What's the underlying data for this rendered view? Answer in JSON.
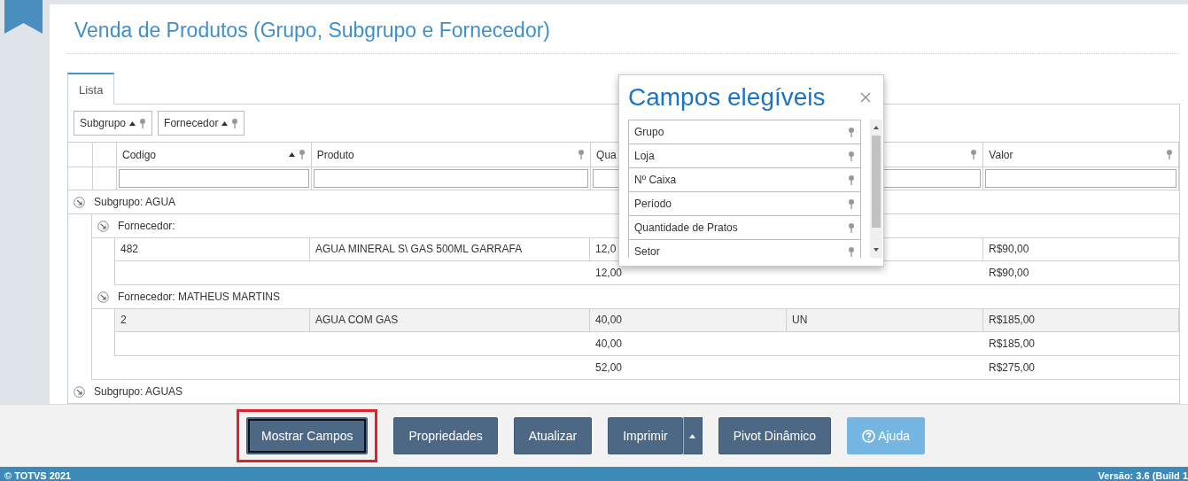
{
  "page": {
    "title": "Venda de Produtos (Grupo, Subgrupo e Fornecedor)"
  },
  "tabs": [
    {
      "label": "Lista",
      "selected": true
    }
  ],
  "group_panel": [
    {
      "label": "Subgrupo",
      "sorted": true
    },
    {
      "label": "Fornecedor",
      "sorted": true
    }
  ],
  "table": {
    "columns": [
      {
        "label": "Codigo",
        "sorted": true
      },
      {
        "label": "Produto",
        "sorted": false
      },
      {
        "label": "Qua",
        "sorted": false
      },
      {
        "sorted": false
      },
      {
        "label": "Valor",
        "sorted": false
      }
    ],
    "groups": [
      {
        "label": "Subgrupo: AGUA",
        "expanded": true,
        "children": [
          {
            "label": "Fornecedor:",
            "expanded": true,
            "rows": [
              {
                "cells": [
                  "482",
                  "AGUA MINERAL S\\ GAS 500ML GARRAFA",
                  "12,0",
                  null,
                  "R$90,00"
                ],
                "selected": false
              }
            ],
            "summary": {
              "col_3": "12,00",
              "col_5": "R$90,00"
            }
          },
          {
            "label": "Fornecedor: MATHEUS MARTINS",
            "expanded": true,
            "rows": [
              {
                "cells": [
                  "2",
                  "AGUA COM GAS",
                  "40,00",
                  "UN",
                  "R$185,00"
                ],
                "selected": true
              }
            ],
            "summary": {
              "col_3": "40,00",
              "col_5": "R$185,00"
            }
          }
        ],
        "summary": {
          "col_3": "52,00",
          "col_5": "R$275,00"
        }
      },
      {
        "label": "Subgrupo: AGUAS",
        "expanded": true
      }
    ]
  },
  "dialog": {
    "title": "Campos elegíveis",
    "fields": [
      "Grupo",
      "Loja",
      "Nº Caixa",
      "Período",
      "Quantidade de Pratos",
      "Setor"
    ]
  },
  "buttons": [
    {
      "label": "Mostrar Campos",
      "kind": "plain",
      "focused": true,
      "highlighted": true,
      "disabled": false
    },
    {
      "label": "Propriedades",
      "kind": "plain",
      "focused": false,
      "highlighted": false,
      "disabled": false
    },
    {
      "label": "Atualizar",
      "kind": "plain",
      "focused": false,
      "highlighted": false,
      "disabled": false
    },
    {
      "label": "Imprimir",
      "kind": "split",
      "focused": false,
      "highlighted": false,
      "disabled": false
    },
    {
      "label": "Pivot Dinâmico",
      "kind": "plain",
      "focused": false,
      "highlighted": false,
      "disabled": false
    },
    {
      "label": "Ajuda",
      "kind": "help",
      "focused": false,
      "highlighted": false,
      "disabled": true
    }
  ],
  "footer": {
    "copyright": "© TOTVS 2021",
    "version": "Versão: 3.6 (Build 1"
  }
}
